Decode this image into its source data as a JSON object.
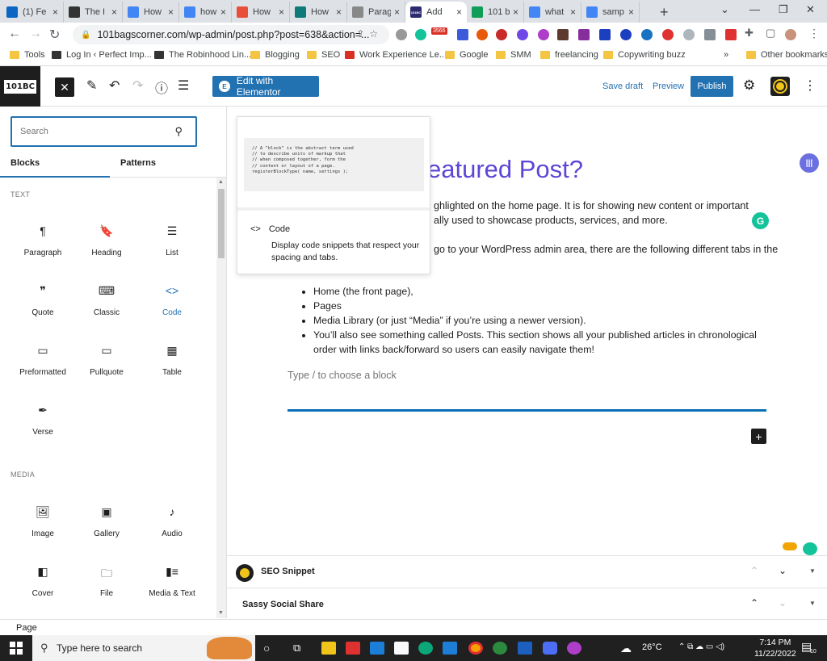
{
  "browser": {
    "tabs": [
      {
        "label": "(1) Fe",
        "favicon": "linkedin-icon",
        "color": "#0a66c2"
      },
      {
        "label": "The I",
        "favicon": "robinhood-icon",
        "color": "#333333"
      },
      {
        "label": "How",
        "favicon": "google-docs-icon",
        "color": "#4285f4"
      },
      {
        "label": "how",
        "favicon": "google-icon",
        "color": "#4285f4"
      },
      {
        "label": "How",
        "favicon": "vedantu-icon",
        "color": "#e94e3b"
      },
      {
        "label": "How",
        "favicon": "site-icon",
        "color": "#0f7a7a"
      },
      {
        "label": "Parag",
        "favicon": "feather-icon",
        "color": "#888888"
      },
      {
        "label": "Add",
        "favicon": "101bc-icon",
        "color": "#2b2b6f",
        "favicon_text": "101BC",
        "active": true
      },
      {
        "label": "101 b",
        "favicon": "google-sheets-icon",
        "color": "#0f9d58"
      },
      {
        "label": "what",
        "favicon": "google-icon",
        "color": "#4285f4"
      },
      {
        "label": "samp",
        "favicon": "google-icon",
        "color": "#4285f4"
      }
    ],
    "tab_close": "×",
    "new_tab": "+",
    "window_controls": [
      "⌄",
      "—",
      "❐",
      "✕"
    ],
    "url": "101bagscorner.com/wp-admin/post.php?post=638&action=...",
    "extension_badge": "3566",
    "bookmarks": [
      {
        "label": "Tools",
        "icon": "folder-icon"
      },
      {
        "label": "Log In ‹ Perfect Imp...",
        "icon": "perfect-imperfections-icon"
      },
      {
        "label": "The Robinhood Lin...",
        "icon": "robinhood-icon"
      },
      {
        "label": "Blogging",
        "icon": "folder-icon"
      },
      {
        "label": "SEO",
        "icon": "folder-icon"
      },
      {
        "label": "Work Experience Le...",
        "icon": "maple-leaf-icon"
      },
      {
        "label": "Google",
        "icon": "folder-icon"
      },
      {
        "label": "SMM",
        "icon": "folder-icon"
      },
      {
        "label": "freelancing",
        "icon": "folder-icon"
      },
      {
        "label": "Copywriting buzz",
        "icon": "folder-icon"
      }
    ],
    "bookmarks_overflow": "»",
    "other_bookmarks": "Other bookmarks"
  },
  "wp": {
    "logo_text": "101BC",
    "edit_elementor": "Edit with Elementor",
    "save_draft": "Save draft",
    "preview": "Preview",
    "publish": "Publish"
  },
  "inserter": {
    "search_placeholder": "Search",
    "tabs": [
      "Blocks",
      "Patterns"
    ],
    "text_category": "TEXT",
    "media_category": "MEDIA",
    "text_blocks": [
      {
        "label": "Paragraph",
        "glyph": "¶"
      },
      {
        "label": "Heading",
        "glyph": "🔖"
      },
      {
        "label": "List",
        "glyph": "☰"
      },
      {
        "label": "Quote",
        "glyph": "❞"
      },
      {
        "label": "Classic",
        "glyph": "⌨"
      },
      {
        "label": "Code",
        "glyph": "<>",
        "selected": true
      },
      {
        "label": "Preformatted",
        "glyph": "▭"
      },
      {
        "label": "Pullquote",
        "glyph": "▭"
      },
      {
        "label": "Table",
        "glyph": "▦"
      },
      {
        "label": "Verse",
        "glyph": "✒"
      }
    ],
    "media_blocks": [
      {
        "label": "Image",
        "glyph": "🖼"
      },
      {
        "label": "Gallery",
        "glyph": "▣"
      },
      {
        "label": "Audio",
        "glyph": "♪"
      },
      {
        "label": "Cover",
        "glyph": "◧"
      },
      {
        "label": "File",
        "glyph": "🗀"
      },
      {
        "label": "Media & Text",
        "glyph": "▮≡"
      }
    ]
  },
  "block_preview": {
    "code_sample": "// A \"block\" is the abstract term used\n// to describe units of markup that\n// when composed together, form the\n// content or layout of a page.\nregisterBlockType( name, settings );",
    "title": "Code",
    "description": "Display code snippets that respect your spacing and tabs."
  },
  "editor": {
    "title_visible": "eatured Post?",
    "para1_line1": "ghlighted on the home page. It is for showing new content or important",
    "para1_line2": "ally used to showcase products, services, and more.",
    "para2_line1": "go to your WordPress admin area, there are the following different tabs in the",
    "list_items": [
      "Home (the front page),",
      "Pages",
      "Media Library (or just “Media” if you’re using a newer version).",
      "You’ll also see something called Posts. This section shows all your published articles in chronological order with links back/forward so users can easily navigate them!"
    ],
    "block_placeholder": "Type / to choose a block",
    "add_block": "+"
  },
  "panels": {
    "seo_snippet": "SEO Snippet",
    "sassy_social": "Sassy Social Share"
  },
  "status": {
    "breadcrumb": "Page"
  },
  "taskbar": {
    "search_placeholder": "Type here to search",
    "temperature": "26°C",
    "time": "7:14 PM",
    "date": "11/22/2022",
    "notification_count": "10"
  }
}
